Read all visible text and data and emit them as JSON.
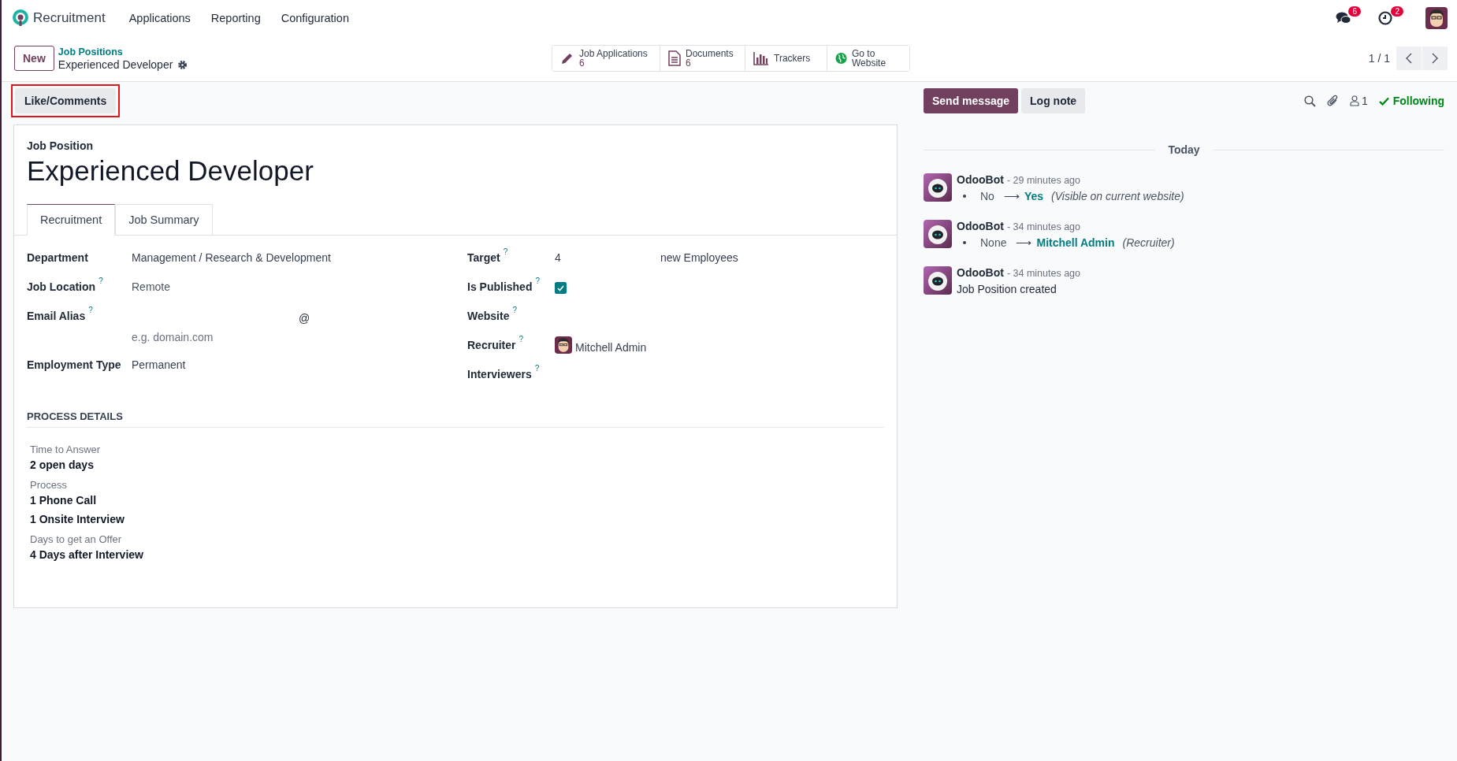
{
  "navbar": {
    "app_name": "Recruitment",
    "menus": [
      "Applications",
      "Reporting",
      "Configuration"
    ],
    "messages_badge": "6",
    "activities_badge": "2"
  },
  "control_panel": {
    "new_button": "New",
    "breadcrumb_parent": "Job Positions",
    "breadcrumb_current": "Experienced Developer",
    "smart_buttons": [
      {
        "label": "Job Applications",
        "count": "6"
      },
      {
        "label": "Documents",
        "count": "6"
      },
      {
        "label": "Trackers"
      },
      {
        "label": "Go to Website"
      }
    ],
    "pager": "1 / 1"
  },
  "status_bar": {
    "like_button": "Like/Comments"
  },
  "form": {
    "overline": "Job Position",
    "title": "Experienced Developer",
    "tabs": [
      {
        "label": "Recruitment",
        "selected": true
      },
      {
        "label": "Job Summary",
        "selected": false
      }
    ],
    "left_fields": [
      {
        "label": "Department",
        "kind": "text",
        "value": "Management / Research & Development"
      },
      {
        "label": "Job Location",
        "help": "?",
        "kind": "muted",
        "value": "Remote"
      },
      {
        "label": "Email Alias",
        "help": "?",
        "kind": "alias",
        "at": "@",
        "placeholder": "e.g. domain.com"
      },
      {
        "label": "Employment Type",
        "kind": "text",
        "value": "Permanent"
      }
    ],
    "right_fields": [
      {
        "label": "Target",
        "help": "?",
        "kind": "target",
        "value": "4",
        "suffix": "new Employees"
      },
      {
        "label": "Is Published",
        "help": "?",
        "kind": "checkbox",
        "checked": true
      },
      {
        "label": "Website",
        "help": "?",
        "kind": "empty"
      },
      {
        "label": "Recruiter",
        "help": "?",
        "kind": "user",
        "value": "Mitchell Admin"
      },
      {
        "label": "Interviewers",
        "help": "?",
        "kind": "empty"
      }
    ],
    "process_title": "PROCESS DETAILS",
    "process": [
      {
        "label": "Time to Answer",
        "values": [
          "2 open days"
        ]
      },
      {
        "label": "Process",
        "values": [
          "1 Phone Call",
          "1 Onsite Interview"
        ]
      },
      {
        "label": "Days to get an Offer",
        "values": [
          "4 Days after Interview"
        ]
      }
    ]
  },
  "chatter": {
    "send_button": "Send message",
    "log_button": "Log note",
    "followers_count": "1",
    "following": "Following",
    "date_label": "Today",
    "messages": [
      {
        "author": "OdooBot",
        "time": "- 29 minutes ago",
        "kind": "tracking",
        "old": "No",
        "arrow": "⟶",
        "new": "Yes",
        "field": "(Visible on current website)"
      },
      {
        "author": "OdooBot",
        "time": "- 34 minutes ago",
        "kind": "tracking",
        "old": "None",
        "arrow": "⟶",
        "new": "Mitchell Admin",
        "field": "(Recruiter)"
      },
      {
        "author": "OdooBot",
        "time": "- 34 minutes ago",
        "kind": "note",
        "body": "Job Position created"
      }
    ]
  }
}
